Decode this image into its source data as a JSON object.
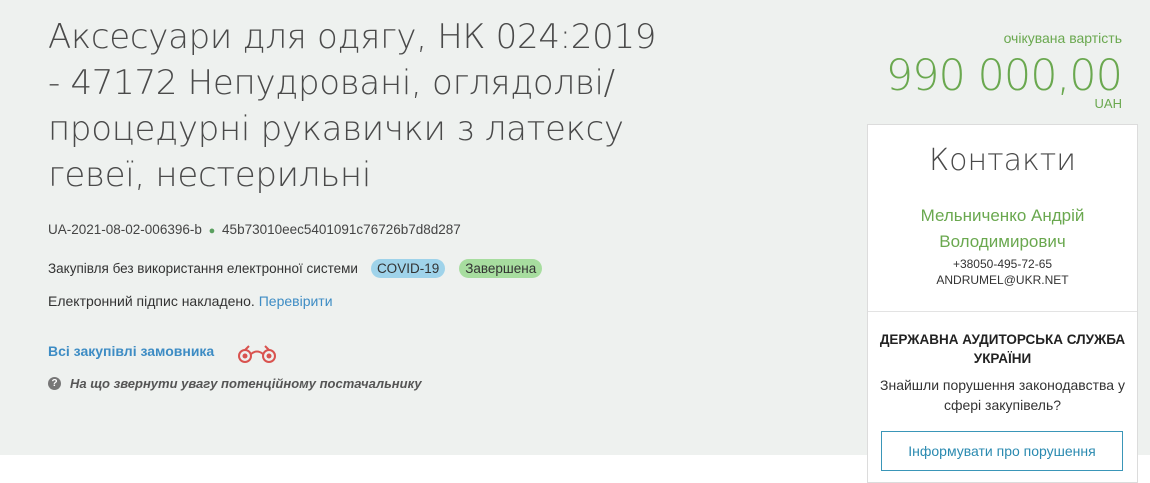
{
  "tender": {
    "title": "Аксесуари для одягу, НК 024:2019 - 47172 Непудровані, оглядолві/ процедурні рукавички з латексу гевеї, нестерильні",
    "id": "UA-2021-08-02-006396-b",
    "hash": "45b73010eec5401091c76726b7d8d287",
    "procurement_type": "Закупівля без використання електронної системи",
    "badges": {
      "covid": "COVID-19",
      "status": "Завершена"
    },
    "signature_text": "Електронний підпис накладено.",
    "signature_link": "Перевірити",
    "all_purchases_link": "Всі закупівлі замовника",
    "hint": "На що звернути увагу потенційному постачальнику"
  },
  "price": {
    "caption": "очікувана вартість",
    "value": "990 000,00",
    "currency": "UAH"
  },
  "contacts": {
    "title": "Контакти",
    "name": "Мельниченко Андрій Володимирович",
    "phone": "+38050-495-72-65",
    "email": "ANDRUMEL@UKR.NET"
  },
  "audit": {
    "title": "ДЕРЖАВНА АУДИТОРСЬКА СЛУЖБА УКРАЇНИ",
    "text": "Знайшли порушення законодавства у сфері закупівель?",
    "button": "Інформувати про порушення"
  },
  "colors": {
    "accent_green": "#6aa84f",
    "link_blue": "#3d8cc4",
    "covid_badge": "#9fd3ea",
    "status_badge": "#a7dd9f",
    "binoculars": "#d9534f"
  },
  "icons": {
    "binoculars": "binoculars-icon",
    "hint": "question-circle-icon"
  }
}
